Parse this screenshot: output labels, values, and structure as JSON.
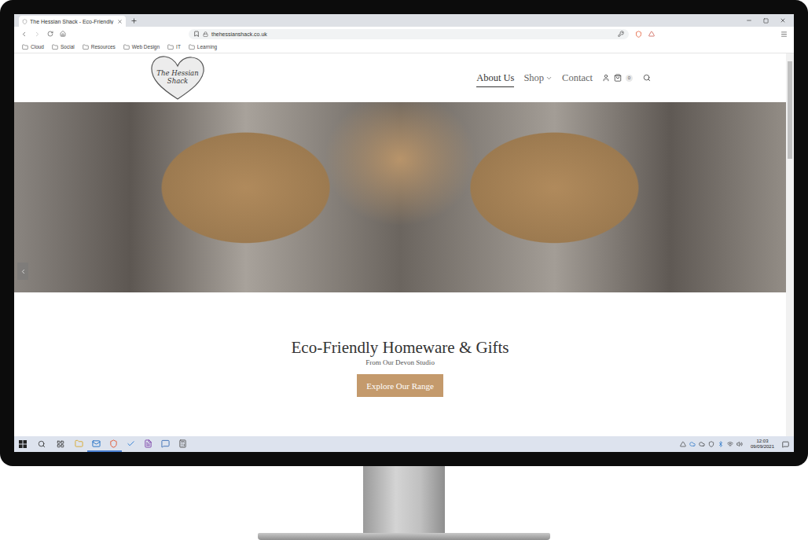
{
  "browser": {
    "tab_title": "The Hessian Shack - Eco-Friendly",
    "url": "thehessianshack.co.uk"
  },
  "bookmarks": [
    "Cloud",
    "Social",
    "Resources",
    "Web Design",
    "IT",
    "Learning"
  ],
  "site": {
    "logo": "The Hessian Shack",
    "nav": [
      {
        "label": "About Us",
        "selected": true,
        "dropdown": false
      },
      {
        "label": "Shop",
        "selected": false,
        "dropdown": true
      },
      {
        "label": "Contact",
        "selected": false,
        "dropdown": false
      }
    ],
    "cart_count": "0",
    "heading": "Eco-Friendly Homeware & Gifts",
    "subheading": "From Our Devon Studio",
    "button": "Explore Our Range"
  },
  "taskbar": {
    "time": "12:03",
    "date": "09/09/2021"
  }
}
